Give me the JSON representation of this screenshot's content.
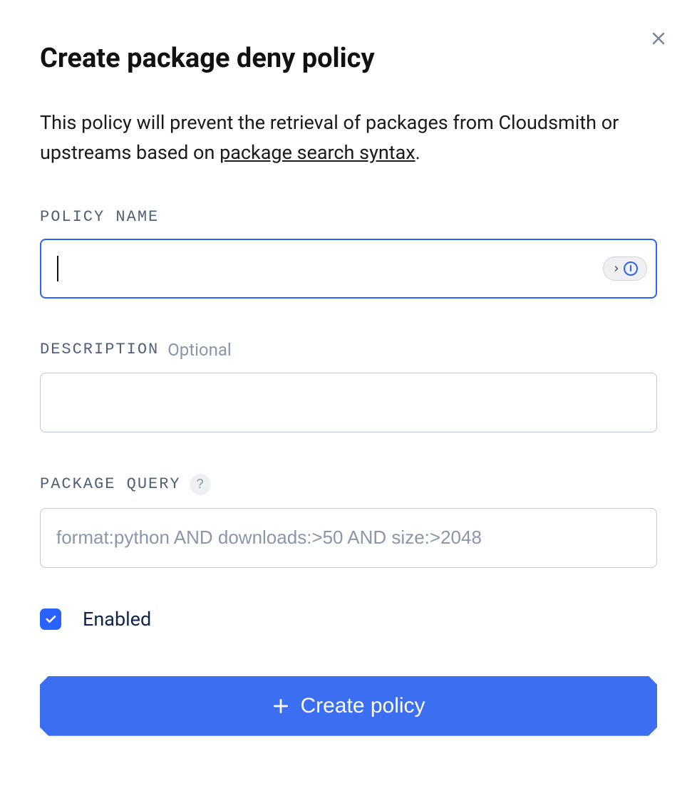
{
  "dialog": {
    "title": "Create package deny policy",
    "description_prefix": "This policy will prevent the retrieval of packages from Cloudsmith or upstreams based on ",
    "description_link": "package search syntax",
    "description_suffix": "."
  },
  "fields": {
    "policy_name": {
      "label": "POLICY NAME",
      "value": ""
    },
    "description": {
      "label": "DESCRIPTION",
      "optional_hint": "Optional",
      "value": ""
    },
    "package_query": {
      "label": "PACKAGE QUERY",
      "placeholder": "format:python AND downloads:>50 AND size:>2048",
      "value": ""
    }
  },
  "enabled": {
    "label": "Enabled",
    "checked": true
  },
  "submit": {
    "label": "Create policy"
  }
}
